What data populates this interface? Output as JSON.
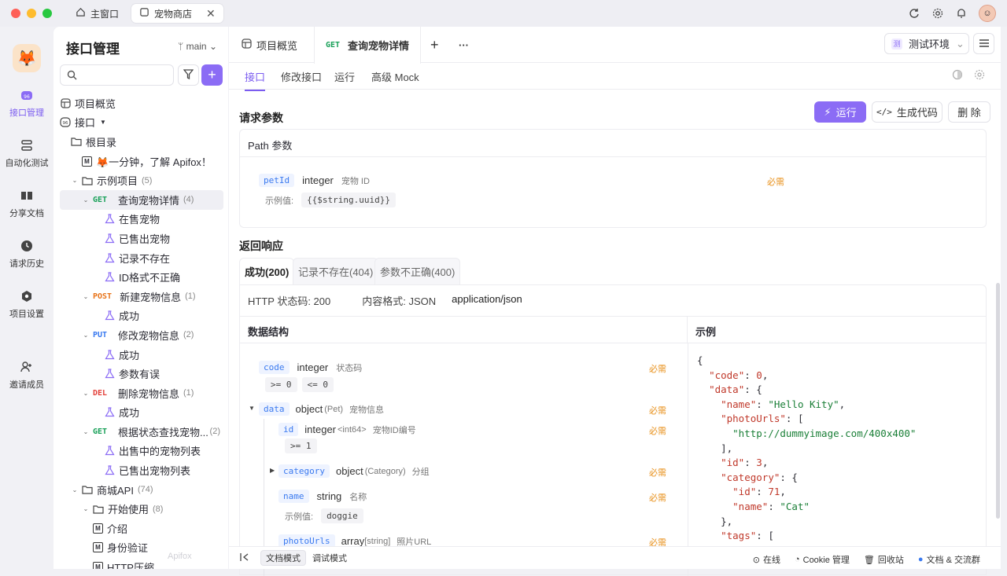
{
  "window": {
    "tabs": [
      {
        "label": "主窗口",
        "icon": "home-icon"
      },
      {
        "label": "宠物商店",
        "icon": "app-icon"
      }
    ]
  },
  "rail": {
    "items": [
      {
        "label": "接口管理",
        "icon": "api-icon"
      },
      {
        "label": "自动化测试",
        "icon": "flow-icon"
      },
      {
        "label": "分享文档",
        "icon": "book-icon"
      },
      {
        "label": "请求历史",
        "icon": "clock-icon"
      },
      {
        "label": "项目设置",
        "icon": "hexagon-icon"
      },
      {
        "label": "邀请成员",
        "icon": "add-user-icon"
      }
    ]
  },
  "panel": {
    "title": "接口管理",
    "branch": "main",
    "watermark": "Apifox"
  },
  "tree": [
    {
      "label": "项目概览",
      "type": "overview",
      "indent": 0
    },
    {
      "label": "接口",
      "type": "api-root",
      "indent": 0,
      "caret": "▾"
    },
    {
      "label": "根目录",
      "type": "folder",
      "indent": 1
    },
    {
      "label": "🦊一分钟，了解 Apifox！",
      "type": "doc",
      "indent": 2
    },
    {
      "label": "示例项目",
      "count": "(5)",
      "type": "folder",
      "indent": 1,
      "caret": "⌄"
    },
    {
      "label": "查询宠物详情",
      "count": "(4)",
      "method": "GET",
      "type": "endpoint",
      "indent": 2,
      "caret": "⌄",
      "selected": true
    },
    {
      "label": "在售宠物",
      "type": "case",
      "indent": 4
    },
    {
      "label": "已售出宠物",
      "type": "case",
      "indent": 4
    },
    {
      "label": "记录不存在",
      "type": "case",
      "indent": 4
    },
    {
      "label": "ID格式不正确",
      "type": "case",
      "indent": 4
    },
    {
      "label": "新建宠物信息",
      "count": "(1)",
      "method": "POST",
      "type": "endpoint",
      "indent": 2,
      "caret": "⌄"
    },
    {
      "label": "成功",
      "type": "case",
      "indent": 4
    },
    {
      "label": "修改宠物信息",
      "count": "(2)",
      "method": "PUT",
      "type": "endpoint",
      "indent": 2,
      "caret": "⌄"
    },
    {
      "label": "成功",
      "type": "case",
      "indent": 4
    },
    {
      "label": "参数有误",
      "type": "case",
      "indent": 4
    },
    {
      "label": "删除宠物信息",
      "count": "(1)",
      "method": "DEL",
      "type": "endpoint",
      "indent": 2,
      "caret": "⌄"
    },
    {
      "label": "成功",
      "type": "case",
      "indent": 4
    },
    {
      "label": "根据状态查找宠物...",
      "count": "(2)",
      "method": "GET",
      "type": "endpoint",
      "indent": 2,
      "caret": "⌄"
    },
    {
      "label": "出售中的宠物列表",
      "type": "case",
      "indent": 4
    },
    {
      "label": "已售出宠物列表",
      "type": "case",
      "indent": 4
    },
    {
      "label": "商城API",
      "count": "(74)",
      "type": "folder",
      "indent": 1,
      "caret": "⌄"
    },
    {
      "label": "开始使用",
      "count": "(8)",
      "type": "folder",
      "indent": 2,
      "caret": "⌄"
    },
    {
      "label": "介绍",
      "type": "doc",
      "indent": 3
    },
    {
      "label": "身份验证",
      "type": "doc",
      "indent": 3
    },
    {
      "label": "HTTP压缩",
      "type": "doc",
      "indent": 3
    }
  ],
  "main": {
    "tabs": {
      "overview": "项目概览",
      "method": "GET",
      "current": "查询宠物详情",
      "add": "+",
      "more": "···"
    },
    "env": {
      "badge": "测",
      "label": "测试环境"
    },
    "subtabs": [
      "接口",
      "修改接口",
      "运行",
      "高级 Mock"
    ],
    "buttons": {
      "run": "运行",
      "gencode": "生成代码",
      "delete": "删 除"
    },
    "request": {
      "title": "请求参数",
      "path_title": "Path 参数",
      "param": {
        "name": "petId",
        "type": "integer",
        "desc": "宠物 ID",
        "required": "必需",
        "example_label": "示例值:",
        "example": "{{$string.uuid}}"
      }
    },
    "response": {
      "title": "返回响应",
      "tabs": [
        "成功(200)",
        "记录不存在(404)",
        "参数不正确(400)"
      ],
      "status": "HTTP 状态码: 200",
      "format": "内容格式: JSON",
      "mime": "application/json",
      "structure_title": "数据结构",
      "example_title": "示例",
      "fields": {
        "code": {
          "name": "code",
          "type": "integer",
          "desc": "状态码",
          "required": "必需",
          "c1": ">= 0",
          "c2": "<= 0"
        },
        "data": {
          "name": "data",
          "type": "object",
          "sub": "(Pet)",
          "desc": "宠物信息",
          "required": "必需"
        },
        "id": {
          "name": "id",
          "type": "integer",
          "sub": "<int64>",
          "desc": "宠物ID编号",
          "required": "必需",
          "c1": ">= 1"
        },
        "category": {
          "name": "category",
          "type": "object",
          "sub": "(Category)",
          "desc": "分组",
          "required": "必需"
        },
        "pname": {
          "name": "name",
          "type": "string",
          "desc": "名称",
          "required": "必需",
          "example_label": "示例值:",
          "example": "doggie"
        },
        "photo": {
          "name": "photoUrls",
          "type": "array",
          "sub": "[string]",
          "desc": "照片URL",
          "required": "必需"
        }
      }
    },
    "json": {
      "code_key": "\"code\"",
      "code_val": "0",
      "data_key": "\"data\"",
      "name_key": "\"name\"",
      "name_val": "\"Hello Kity\"",
      "photo_key": "\"photoUrls\"",
      "photo_val": "\"http://dummyimage.com/400x400\"",
      "id_key": "\"id\"",
      "id_val": "3",
      "cat_key": "\"category\"",
      "cid_key": "\"id\"",
      "cid_val": "71",
      "cname_key": "\"name\"",
      "cname_val": "\"Cat\"",
      "tags_key": "\"tags\""
    }
  },
  "footer": {
    "doc_mode": "文档模式",
    "debug_mode": "调试模式",
    "online": "在线",
    "cookie": "Cookie 管理",
    "trash": "回收站",
    "community": "文档 & 交流群"
  },
  "colors": {
    "accent": "#8b6cf5",
    "get": "#18a058",
    "post": "#e8741a",
    "put": "#3a7af0",
    "del": "#e3413b",
    "required": "#e8901a"
  }
}
